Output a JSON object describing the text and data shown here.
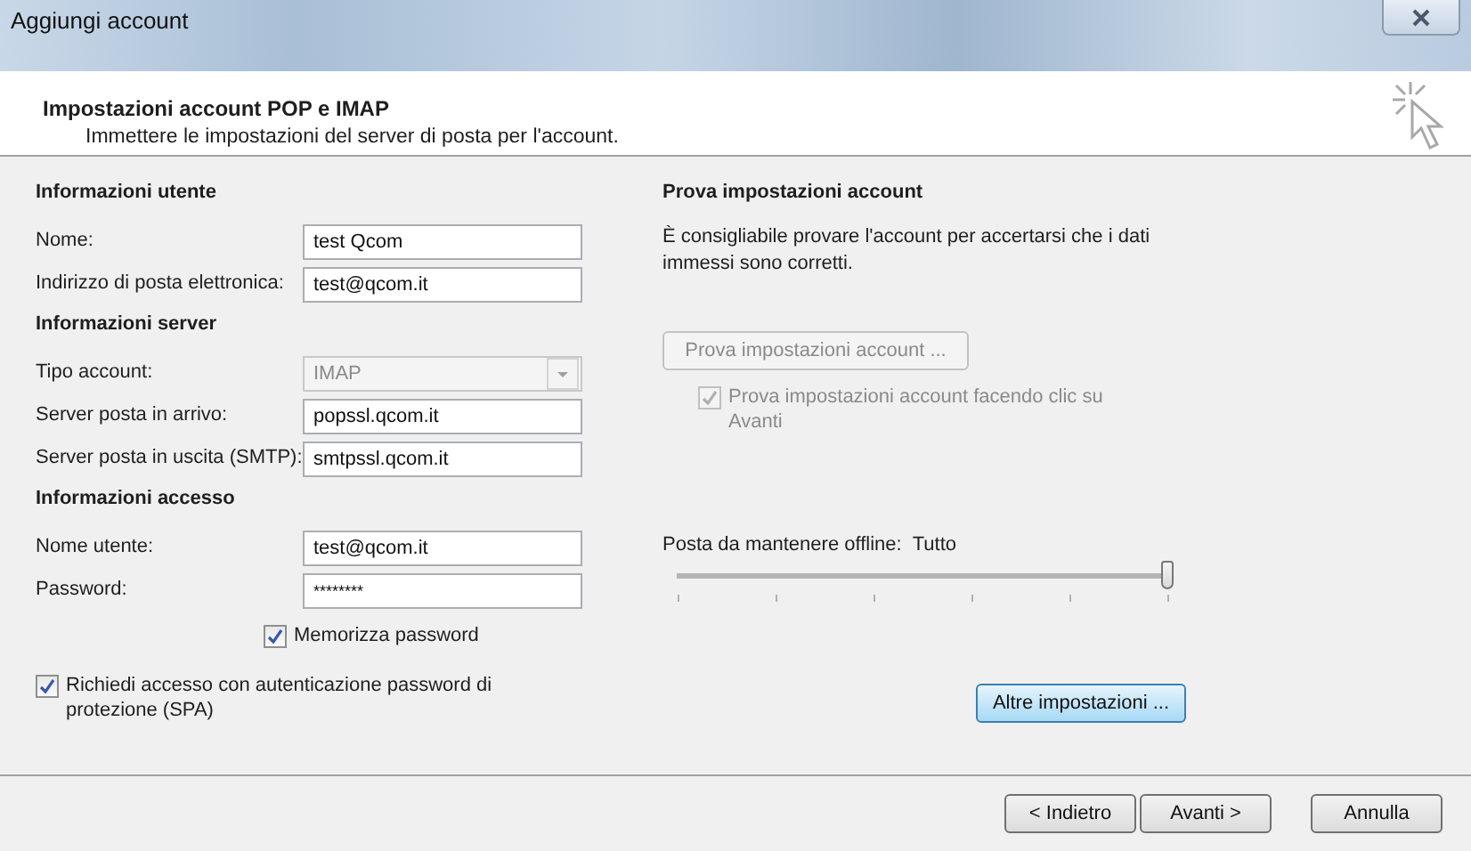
{
  "window": {
    "title": "Aggiungi account"
  },
  "header": {
    "title": "Impostazioni account POP e IMAP",
    "subtitle": "Immettere le impostazioni del server di posta per l'account."
  },
  "sections": [
    {
      "heading": "Informazioni utente",
      "fields": [
        {
          "label": "Nome:",
          "value": "test Qcom",
          "kind": "text",
          "disabled": false
        },
        {
          "label": "Indirizzo di posta elettronica:",
          "value": "test@qcom.it",
          "kind": "text",
          "disabled": false
        }
      ]
    },
    {
      "heading": "Informazioni server",
      "fields": [
        {
          "label": "Tipo account:",
          "value": "IMAP",
          "kind": "select",
          "disabled": true
        },
        {
          "label": "Server posta in arrivo:",
          "value": "popssl.qcom.it",
          "kind": "text",
          "disabled": false
        },
        {
          "label": "Server posta in uscita (SMTP):",
          "value": "smtpssl.qcom.it",
          "kind": "text",
          "disabled": false
        }
      ]
    },
    {
      "heading": "Informazioni accesso",
      "fields": [
        {
          "label": "Nome utente:",
          "value": "test@qcom.it",
          "kind": "text",
          "disabled": false
        },
        {
          "label": "Password:",
          "value": "********",
          "kind": "password",
          "disabled": false
        }
      ]
    }
  ],
  "remember_password": {
    "label": "Memorizza password",
    "checked": true,
    "disabled": false
  },
  "spa": {
    "label": "Richiedi accesso con autenticazione password di protezione (SPA)",
    "checked": true,
    "disabled": false
  },
  "test": {
    "heading": "Prova impostazioni account",
    "description": "È consigliabile provare l'account per accertarsi che i dati immessi sono corretti.",
    "button": {
      "label": "Prova impostazioni account ...",
      "disabled": true
    },
    "on_next": {
      "label": "Prova impostazioni account facendo clic su Avanti",
      "checked": true,
      "disabled": true
    }
  },
  "offline": {
    "label": "Posta da mantenere offline:",
    "value": "Tutto",
    "level": 1
  },
  "more_settings": {
    "label": "Altre impostazioni ...",
    "focused": true
  },
  "footer_buttons": [
    {
      "label": "< Indietro",
      "kind": "nav"
    },
    {
      "label": "Avanti >",
      "kind": "nav"
    },
    {
      "label": "Annulla",
      "kind": "cancel"
    }
  ]
}
